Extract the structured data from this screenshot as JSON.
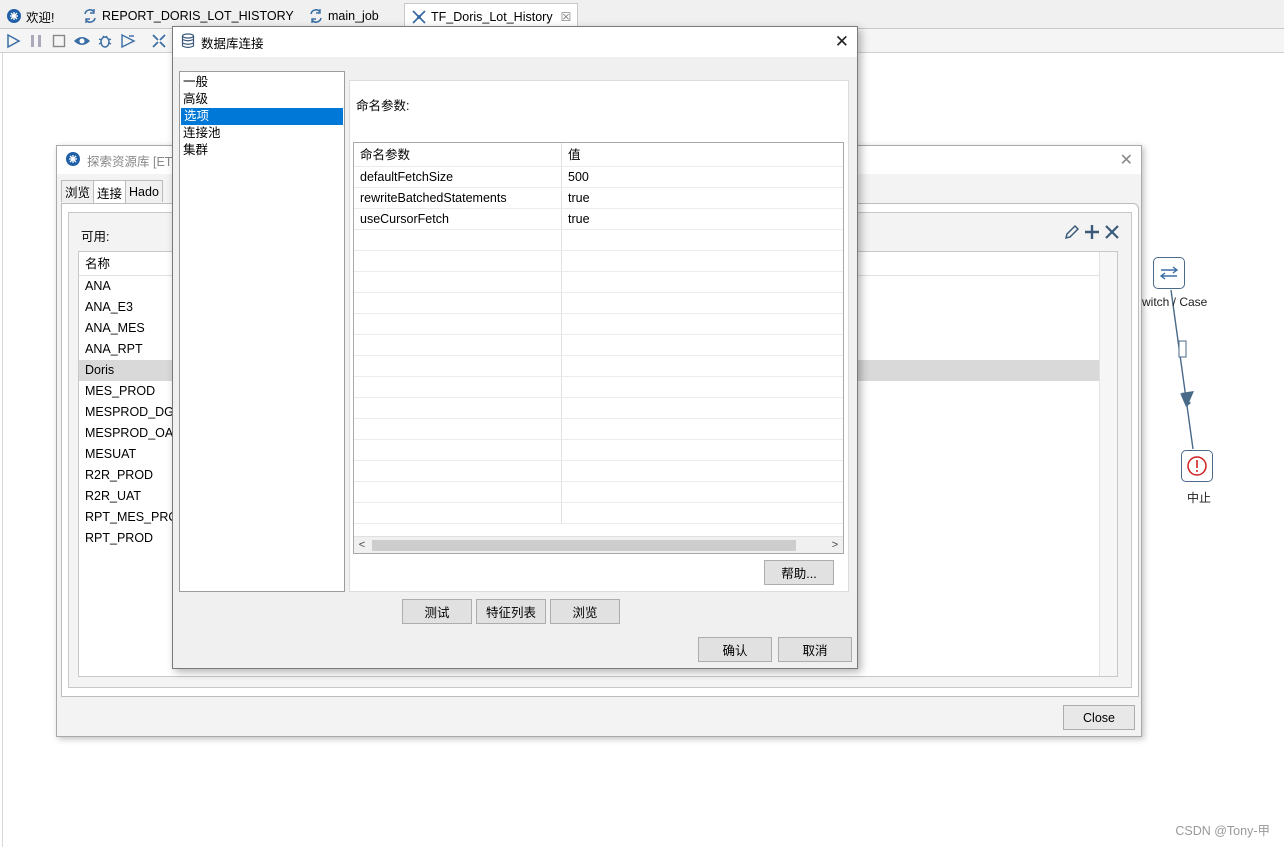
{
  "tabs": [
    {
      "label": "欢迎!",
      "icon": "spoon-icon",
      "active": false
    },
    {
      "label": "REPORT_DORIS_LOT_HISTORY",
      "icon": "job-icon",
      "active": false
    },
    {
      "label": "main_job",
      "icon": "job-icon",
      "active": false
    },
    {
      "label": "TF_Doris_Lot_History",
      "icon": "transformation-icon",
      "active": true,
      "close": "☒"
    }
  ],
  "canvas": {
    "switch_label": "witch / Case",
    "abort_label": "中止"
  },
  "explorer": {
    "title": "探索资源库 [ETL",
    "tabs": [
      "浏览",
      "连接",
      "Hado"
    ],
    "available_label": "可用:",
    "list_header": "名称",
    "connections": [
      "ANA",
      "ANA_E3",
      "ANA_MES",
      "ANA_RPT",
      "Doris",
      "MES_PROD",
      "MESPROD_DG",
      "MESPROD_OA",
      "MESUAT",
      "R2R_PROD",
      "R2R_UAT",
      "RPT_MES_PROD",
      "RPT_PROD"
    ],
    "selected_connection": "Doris",
    "close_button": "Close"
  },
  "db_dialog": {
    "title": "数据库连接",
    "nav": [
      "一般",
      "高级",
      "选项",
      "连接池",
      "集群"
    ],
    "selected_nav": "选项",
    "options_label": "命名参数:",
    "table": {
      "headers": [
        "命名参数",
        "值"
      ],
      "rows": [
        [
          "defaultFetchSize",
          "500"
        ],
        [
          "rewriteBatchedStatements",
          "true"
        ],
        [
          "useCursorFetch",
          "true"
        ]
      ]
    },
    "help_button": "帮助...",
    "test_button": "测试",
    "features_button": "特征列表",
    "browse_button": "浏览",
    "ok_button": "确认",
    "cancel_button": "取消"
  },
  "watermark": "CSDN @Tony-甲"
}
